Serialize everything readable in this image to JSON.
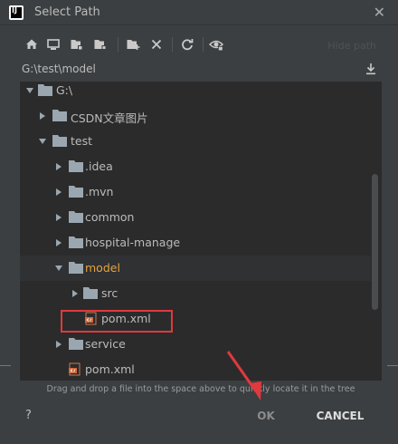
{
  "window": {
    "title": "Select Path",
    "close_icon": "close-icon"
  },
  "toolbar": {
    "buttons": [
      {
        "name": "home-icon"
      },
      {
        "name": "desktop-icon"
      },
      {
        "name": "project-folder-icon"
      },
      {
        "name": "module-folder-icon"
      },
      {
        "name": "new-folder-icon"
      },
      {
        "name": "delete-icon"
      },
      {
        "name": "refresh-icon"
      },
      {
        "name": "show-hidden-icon"
      }
    ],
    "hide_path_label": "Hide path"
  },
  "path": {
    "value": "G:\\test\\model",
    "download_icon": "download-icon"
  },
  "tree": {
    "items": [
      {
        "label": "G:\\",
        "kind": "drive",
        "state": "expanded",
        "depth": 0
      },
      {
        "label": "CSDN文章图片",
        "kind": "folder",
        "state": "collapsed",
        "depth": 1
      },
      {
        "label": "test",
        "kind": "folder",
        "state": "expanded",
        "depth": 1
      },
      {
        "label": ".idea",
        "kind": "folder",
        "state": "collapsed",
        "depth": 2
      },
      {
        "label": ".mvn",
        "kind": "folder",
        "state": "collapsed",
        "depth": 2
      },
      {
        "label": "common",
        "kind": "folder",
        "state": "collapsed",
        "depth": 2
      },
      {
        "label": "hospital-manage",
        "kind": "folder",
        "state": "collapsed",
        "depth": 2
      },
      {
        "label": "model",
        "kind": "folder",
        "state": "expanded",
        "depth": 2,
        "selected": true
      },
      {
        "label": "src",
        "kind": "folder",
        "state": "collapsed",
        "depth": 3
      },
      {
        "label": "pom.xml",
        "kind": "xml",
        "depth": 3,
        "highlighted": true
      },
      {
        "label": "service",
        "kind": "folder",
        "state": "collapsed",
        "depth": 2
      },
      {
        "label": "pom.xml",
        "kind": "xml",
        "depth": 2
      }
    ]
  },
  "hint": "Drag and drop a file into the space above to quickly locate it in the tree",
  "footer": {
    "help": "?",
    "ok": "OK",
    "cancel": "CANCEL"
  },
  "colors": {
    "background": "#3c3f41",
    "tree_background": "#2b2b2b",
    "selected_text": "#e6a23c",
    "annotation_red": "#e0393e",
    "folder": "#9aa7b0",
    "xml": "#d06a3e"
  }
}
